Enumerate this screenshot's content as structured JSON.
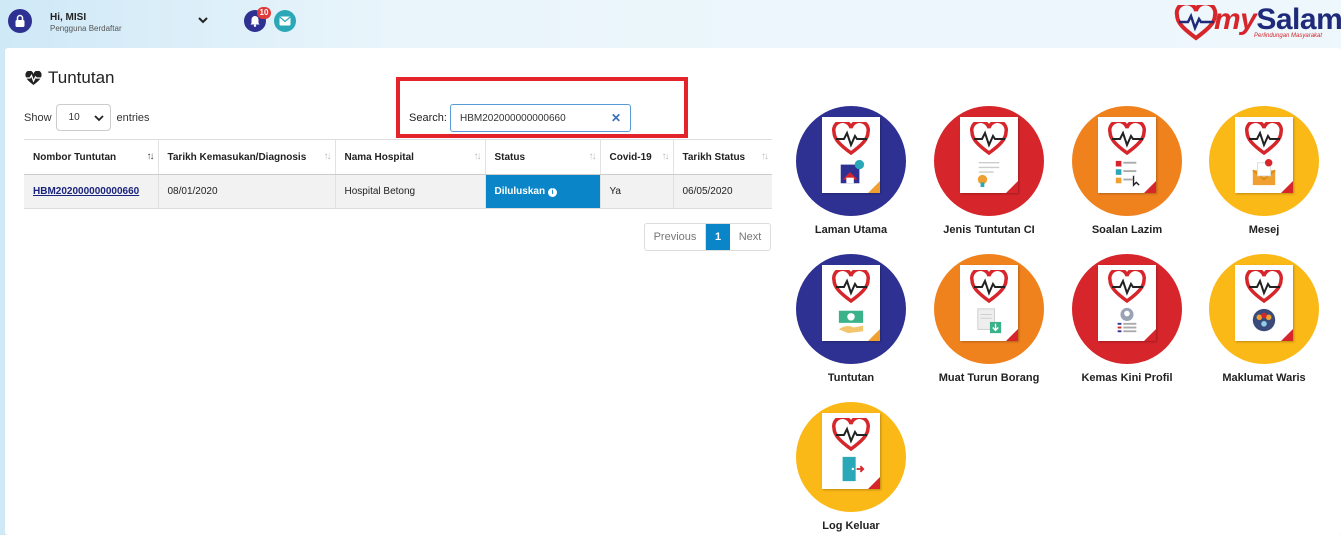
{
  "header": {
    "greeting": "Hi, MISI",
    "role": "Pengguna Berdaftar",
    "notification_count": "10",
    "brand": {
      "my": "my",
      "salam": "Salam",
      "tagline": "Perlindungan Masyarakat"
    }
  },
  "page": {
    "title": "Tuntutan",
    "show_label": "Show",
    "entries_value": "10",
    "entries_label": "entries",
    "search_label": "Search:",
    "search_value": "HBM202000000000660"
  },
  "table": {
    "columns": [
      "Nombor Tuntutan",
      "Tarikh Kemasukan/Diagnosis",
      "Nama Hospital",
      "Status",
      "Covid-19",
      "Tarikh Status"
    ],
    "rows": [
      {
        "nombor": "HBM202000000000660",
        "tarikh_kemasukan": "08/01/2020",
        "hospital": "Hospital Betong",
        "status": "Diluluskan",
        "covid": "Ya",
        "tarikh_status": "06/05/2020"
      }
    ]
  },
  "pagination": {
    "previous": "Previous",
    "current": "1",
    "next": "Next"
  },
  "menu": [
    {
      "label": "Laman Utama",
      "color": "#2e3192",
      "icon": "house-icon"
    },
    {
      "label": "Jenis Tuntutan CI",
      "color": "#d6262b",
      "icon": "certificate-icon"
    },
    {
      "label": "Soalan Lazim",
      "color": "#f0821e",
      "icon": "faq-list-icon"
    },
    {
      "label": "Mesej",
      "color": "#fbb917",
      "icon": "envelope-alert-icon"
    },
    {
      "label": "Tuntutan",
      "color": "#2e3192",
      "icon": "money-hand-icon"
    },
    {
      "label": "Muat Turun Borang",
      "color": "#f0821e",
      "icon": "download-form-icon"
    },
    {
      "label": "Kemas Kini Profil",
      "color": "#d6262b",
      "icon": "profile-card-icon"
    },
    {
      "label": "Maklumat Waris",
      "color": "#fbb917",
      "icon": "family-icon"
    },
    {
      "label": "Log Keluar",
      "color": "#fbb917",
      "icon": "logout-door-icon"
    }
  ],
  "colors": {
    "primary": "#0a86c8",
    "navy": "#2e3192",
    "highlight": "#e3242b"
  }
}
